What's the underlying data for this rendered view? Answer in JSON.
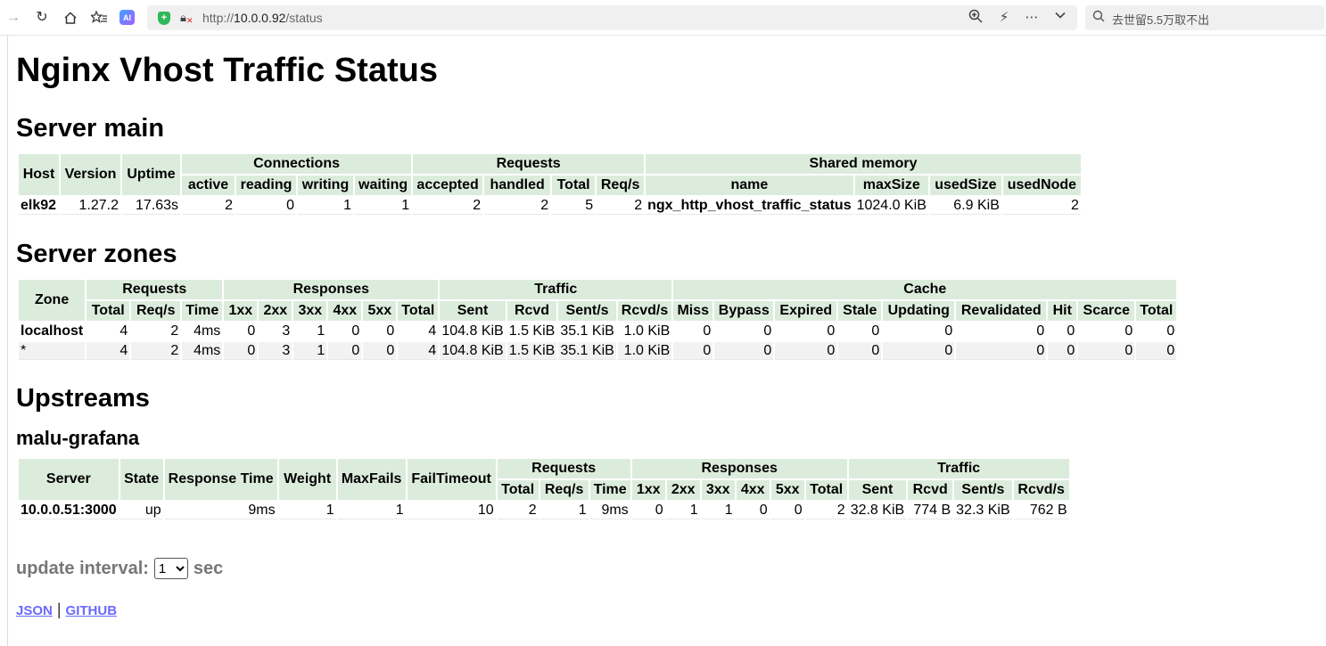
{
  "browser": {
    "url_prefix": "http://",
    "url_host": "10.0.0.92",
    "url_path": "/status",
    "ai_badge": "AI",
    "search_placeholder": "去世留5.5万取不出"
  },
  "page_title": "Nginx Vhost Traffic Status",
  "server_main": {
    "title": "Server main",
    "group_headers": {
      "connections": "Connections",
      "requests": "Requests",
      "shared_memory": "Shared memory"
    },
    "headers": [
      "Host",
      "Version",
      "Uptime",
      "active",
      "reading",
      "writing",
      "waiting",
      "accepted",
      "handled",
      "Total",
      "Req/s",
      "name",
      "maxSize",
      "usedSize",
      "usedNode"
    ],
    "row": [
      "elk92",
      "1.27.2",
      "17.63s",
      "2",
      "0",
      "1",
      "1",
      "2",
      "2",
      "5",
      "2",
      "ngx_http_vhost_traffic_status",
      "1024.0 KiB",
      "6.9 KiB",
      "2"
    ]
  },
  "server_zones": {
    "title": "Server zones",
    "group_headers": {
      "requests": "Requests",
      "responses": "Responses",
      "traffic": "Traffic",
      "cache": "Cache"
    },
    "headers": [
      "Zone",
      "Total",
      "Req/s",
      "Time",
      "1xx",
      "2xx",
      "3xx",
      "4xx",
      "5xx",
      "Total",
      "Sent",
      "Rcvd",
      "Sent/s",
      "Rcvd/s",
      "Miss",
      "Bypass",
      "Expired",
      "Stale",
      "Updating",
      "Revalidated",
      "Hit",
      "Scarce",
      "Total"
    ],
    "rows": [
      [
        "localhost",
        "4",
        "2",
        "4ms",
        "0",
        "3",
        "1",
        "0",
        "0",
        "4",
        "104.8 KiB",
        "1.5 KiB",
        "35.1 KiB",
        "1.0 KiB",
        "0",
        "0",
        "0",
        "0",
        "0",
        "0",
        "0",
        "0",
        "0"
      ],
      [
        "*",
        "4",
        "2",
        "4ms",
        "0",
        "3",
        "1",
        "0",
        "0",
        "4",
        "104.8 KiB",
        "1.5 KiB",
        "35.1 KiB",
        "1.0 KiB",
        "0",
        "0",
        "0",
        "0",
        "0",
        "0",
        "0",
        "0",
        "0"
      ]
    ]
  },
  "upstreams": {
    "title": "Upstreams",
    "group_name": "malu-grafana",
    "group_headers": {
      "requests": "Requests",
      "responses": "Responses",
      "traffic": "Traffic"
    },
    "headers": [
      "Server",
      "State",
      "Response Time",
      "Weight",
      "MaxFails",
      "FailTimeout",
      "Total",
      "Req/s",
      "Time",
      "1xx",
      "2xx",
      "3xx",
      "4xx",
      "5xx",
      "Total",
      "Sent",
      "Rcvd",
      "Sent/s",
      "Rcvd/s"
    ],
    "row": [
      "10.0.0.51:3000",
      "up",
      "9ms",
      "1",
      "1",
      "10",
      "2",
      "1",
      "9ms",
      "0",
      "1",
      "1",
      "0",
      "0",
      "2",
      "32.8 KiB",
      "774 B",
      "32.3 KiB",
      "762 B"
    ]
  },
  "footer": {
    "update_label": "update interval:",
    "interval_value": "1",
    "sec_label": "sec",
    "json_link": "JSON",
    "separator": "|",
    "github_link": "GITHUB"
  },
  "colors": {
    "header_bg": "#dcecdc",
    "link": "#6a6aff",
    "even_row": "#f2f2f2"
  }
}
